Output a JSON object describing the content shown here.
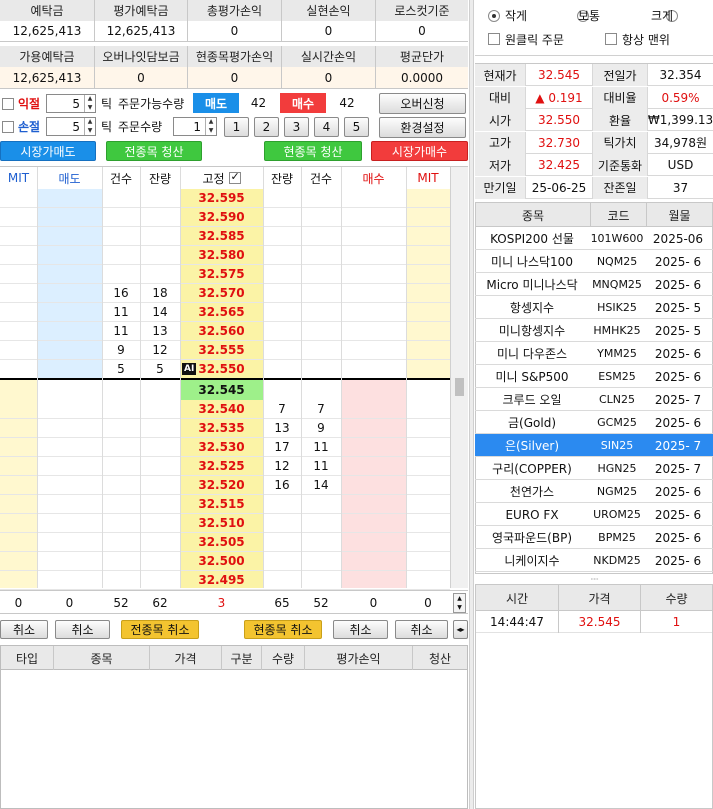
{
  "account": {
    "row1_headers": [
      "예탁금",
      "평가예탁금",
      "총평가손익",
      "실현손익",
      "로스컷기준"
    ],
    "row1_values": [
      "12,625,413",
      "12,625,413",
      "0",
      "0",
      "0"
    ],
    "row2_headers": [
      "가용예탁금",
      "오버나잇담보금",
      "현종목평가손익",
      "실시간손익",
      "평균단가"
    ],
    "row2_values": [
      "12,625,413",
      "0",
      "0",
      "0",
      "0.0000"
    ]
  },
  "order_panel": {
    "ikjeol_label": "익절",
    "sonjeol_label": "손절",
    "ikjeol_tick": "5",
    "sonjeol_tick": "5",
    "tick_label_1": "틱",
    "tick_label_2": "틱",
    "available_qty_label": "주문가능수량",
    "sell_label": "매도",
    "sell_qty": "42",
    "buy_label": "매수",
    "buy_qty": "42",
    "overnight_button": "오버신청",
    "order_qty_label": "주문수량",
    "order_qty": "1",
    "qty_presets": [
      "1",
      "2",
      "3",
      "4",
      "5"
    ],
    "settings_button": "환경설정",
    "market_sell_button": "시장가매도",
    "all_liquidate_button": "전종목 청산",
    "current_liquidate_button": "현종목 청산",
    "market_buy_button": "시장가매수"
  },
  "ladder": {
    "headers": [
      "MIT",
      "매도",
      "건수",
      "잔량",
      "고정",
      "잔량",
      "건수",
      "매수",
      "MIT"
    ],
    "current_price": "32.545",
    "ai_badge": "AI",
    "ask_rows": [
      {
        "price": "32.595",
        "cnt": "",
        "qty": ""
      },
      {
        "price": "32.590",
        "cnt": "",
        "qty": ""
      },
      {
        "price": "32.585",
        "cnt": "",
        "qty": ""
      },
      {
        "price": "32.580",
        "cnt": "",
        "qty": ""
      },
      {
        "price": "32.575",
        "cnt": "",
        "qty": ""
      },
      {
        "price": "32.570",
        "cnt": "16",
        "qty": "18"
      },
      {
        "price": "32.565",
        "cnt": "11",
        "qty": "14"
      },
      {
        "price": "32.560",
        "cnt": "11",
        "qty": "13"
      },
      {
        "price": "32.555",
        "cnt": "9",
        "qty": "12"
      },
      {
        "price": "32.550",
        "cnt": "5",
        "qty": "5"
      }
    ],
    "bid_rows": [
      {
        "price": "32.540",
        "qty": "7",
        "cnt": "7"
      },
      {
        "price": "32.535",
        "qty": "13",
        "cnt": "9"
      },
      {
        "price": "32.530",
        "qty": "17",
        "cnt": "11"
      },
      {
        "price": "32.525",
        "qty": "12",
        "cnt": "11"
      },
      {
        "price": "32.520",
        "qty": "16",
        "cnt": "14"
      },
      {
        "price": "32.515",
        "qty": "",
        "cnt": ""
      },
      {
        "price": "32.510",
        "qty": "",
        "cnt": ""
      },
      {
        "price": "32.505",
        "qty": "",
        "cnt": ""
      },
      {
        "price": "32.500",
        "qty": "",
        "cnt": ""
      },
      {
        "price": "32.495",
        "qty": "",
        "cnt": ""
      }
    ],
    "totals": [
      "0",
      "0",
      "52",
      "62",
      "3",
      "65",
      "52",
      "0",
      "0"
    ],
    "cancel_buttons": [
      "취소",
      "취소",
      "전종목 취소",
      "현종목 취소",
      "취소",
      "취소"
    ]
  },
  "positions": {
    "headers": [
      "타입",
      "종목",
      "가격",
      "구분",
      "수량",
      "평가손익",
      "청산"
    ]
  },
  "view": {
    "size_options": [
      "작게",
      "보통",
      "크게"
    ],
    "one_click_label": "원클릭 주문",
    "always_on_top_label": "항상 맨위"
  },
  "quote": {
    "rows": [
      {
        "l1": "현재가",
        "v1": "32.545",
        "l2": "전일가",
        "v2": "32.354"
      },
      {
        "l1": "대비",
        "v1": "▲ 0.191",
        "l2": "대비율",
        "v2": "0.59%"
      },
      {
        "l1": "시가",
        "v1": "32.550",
        "l2": "환율",
        "v2": "₩1,399.13"
      },
      {
        "l1": "고가",
        "v1": "32.730",
        "l2": "틱가치",
        "v2": "34,978원"
      },
      {
        "l1": "저가",
        "v1": "32.425",
        "l2": "기준통화",
        "v2": "USD"
      },
      {
        "l1": "만기일",
        "v1": "25-06-25",
        "l2": "잔존일",
        "v2": "37"
      }
    ]
  },
  "symbols": {
    "headers": [
      "종목",
      "코드",
      "월물"
    ],
    "rows": [
      {
        "name": "KOSPI200 선물",
        "code": "101W600",
        "month": "2025-06"
      },
      {
        "name": "미니 나스닥100",
        "code": "NQM25",
        "month": "2025- 6"
      },
      {
        "name": "Micro 미니나스닥",
        "code": "MNQM25",
        "month": "2025- 6"
      },
      {
        "name": "항셍지수",
        "code": "HSIK25",
        "month": "2025- 5"
      },
      {
        "name": "미니항셍지수",
        "code": "HMHK25",
        "month": "2025- 5"
      },
      {
        "name": "미니 다우존스",
        "code": "YMM25",
        "month": "2025- 6"
      },
      {
        "name": "미니 S&P500",
        "code": "ESM25",
        "month": "2025- 6"
      },
      {
        "name": "크루드 오일",
        "code": "CLN25",
        "month": "2025- 7"
      },
      {
        "name": "금(Gold)",
        "code": "GCM25",
        "month": "2025- 6"
      },
      {
        "name": "은(Silver)",
        "code": "SIN25",
        "month": "2025- 7"
      },
      {
        "name": "구리(COPPER)",
        "code": "HGN25",
        "month": "2025- 7"
      },
      {
        "name": "천연가스",
        "code": "NGM25",
        "month": "2025- 6"
      },
      {
        "name": "EURO FX",
        "code": "UROM25",
        "month": "2025- 6"
      },
      {
        "name": "영국파운드(BP)",
        "code": "BPM25",
        "month": "2025- 6"
      },
      {
        "name": "니케이지수",
        "code": "NKDM25",
        "month": "2025- 6"
      }
    ],
    "selected_index": 9
  },
  "trades": {
    "headers": [
      "시간",
      "가격",
      "수량"
    ],
    "rows": [
      {
        "time": "14:44:47",
        "price": "32.545",
        "qty": "1"
      }
    ]
  },
  "colors": {
    "sell_blue": "#1a8fe8",
    "buy_red": "#f23c3c",
    "green": "#3fc83f",
    "price_yellow": "#fbf3a6",
    "current_green": "#9ef08a",
    "selected_blue": "#2b8af0"
  }
}
